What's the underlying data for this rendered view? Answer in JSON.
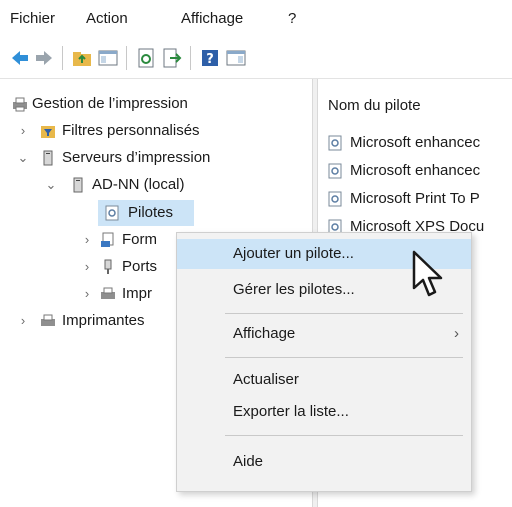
{
  "menubar": {
    "items": [
      "Fichier",
      "Action",
      "Affichage",
      "?"
    ]
  },
  "tree": {
    "root": "Gestion de l’impression",
    "filters": "Filtres personnalisés",
    "servers": "Serveurs d’impression",
    "server": "AD-NN (local)",
    "drivers": "Pilotes",
    "forms": "Form",
    "ports": "Ports",
    "printers_sub": "Impr",
    "deployed": "Imprimantes"
  },
  "right": {
    "header": "Nom du pilote",
    "rows": [
      "Microsoft enhancec",
      "Microsoft enhancec",
      "Microsoft Print To P",
      "Microsoft XPS Docu"
    ]
  },
  "context_menu": {
    "add_driver": "Ajouter un pilote...",
    "manage_drivers": "Gérer les pilotes...",
    "view": "Affichage",
    "submenu_arrow": "›",
    "refresh": "Actualiser",
    "export": "Exporter la liste...",
    "help": "Aide"
  },
  "icons": {
    "back": "back-arrow-icon",
    "forward": "forward-arrow-icon",
    "up": "folder-up-icon",
    "show_hide": "console-tree-icon",
    "refresh": "refresh-icon",
    "export": "export-list-icon",
    "help": "help-icon",
    "action_pane": "action-pane-icon"
  },
  "colors": {
    "selection": "#cce4f7",
    "menu_bg": "#f2f2f2",
    "accent": "#2b6cb0"
  }
}
